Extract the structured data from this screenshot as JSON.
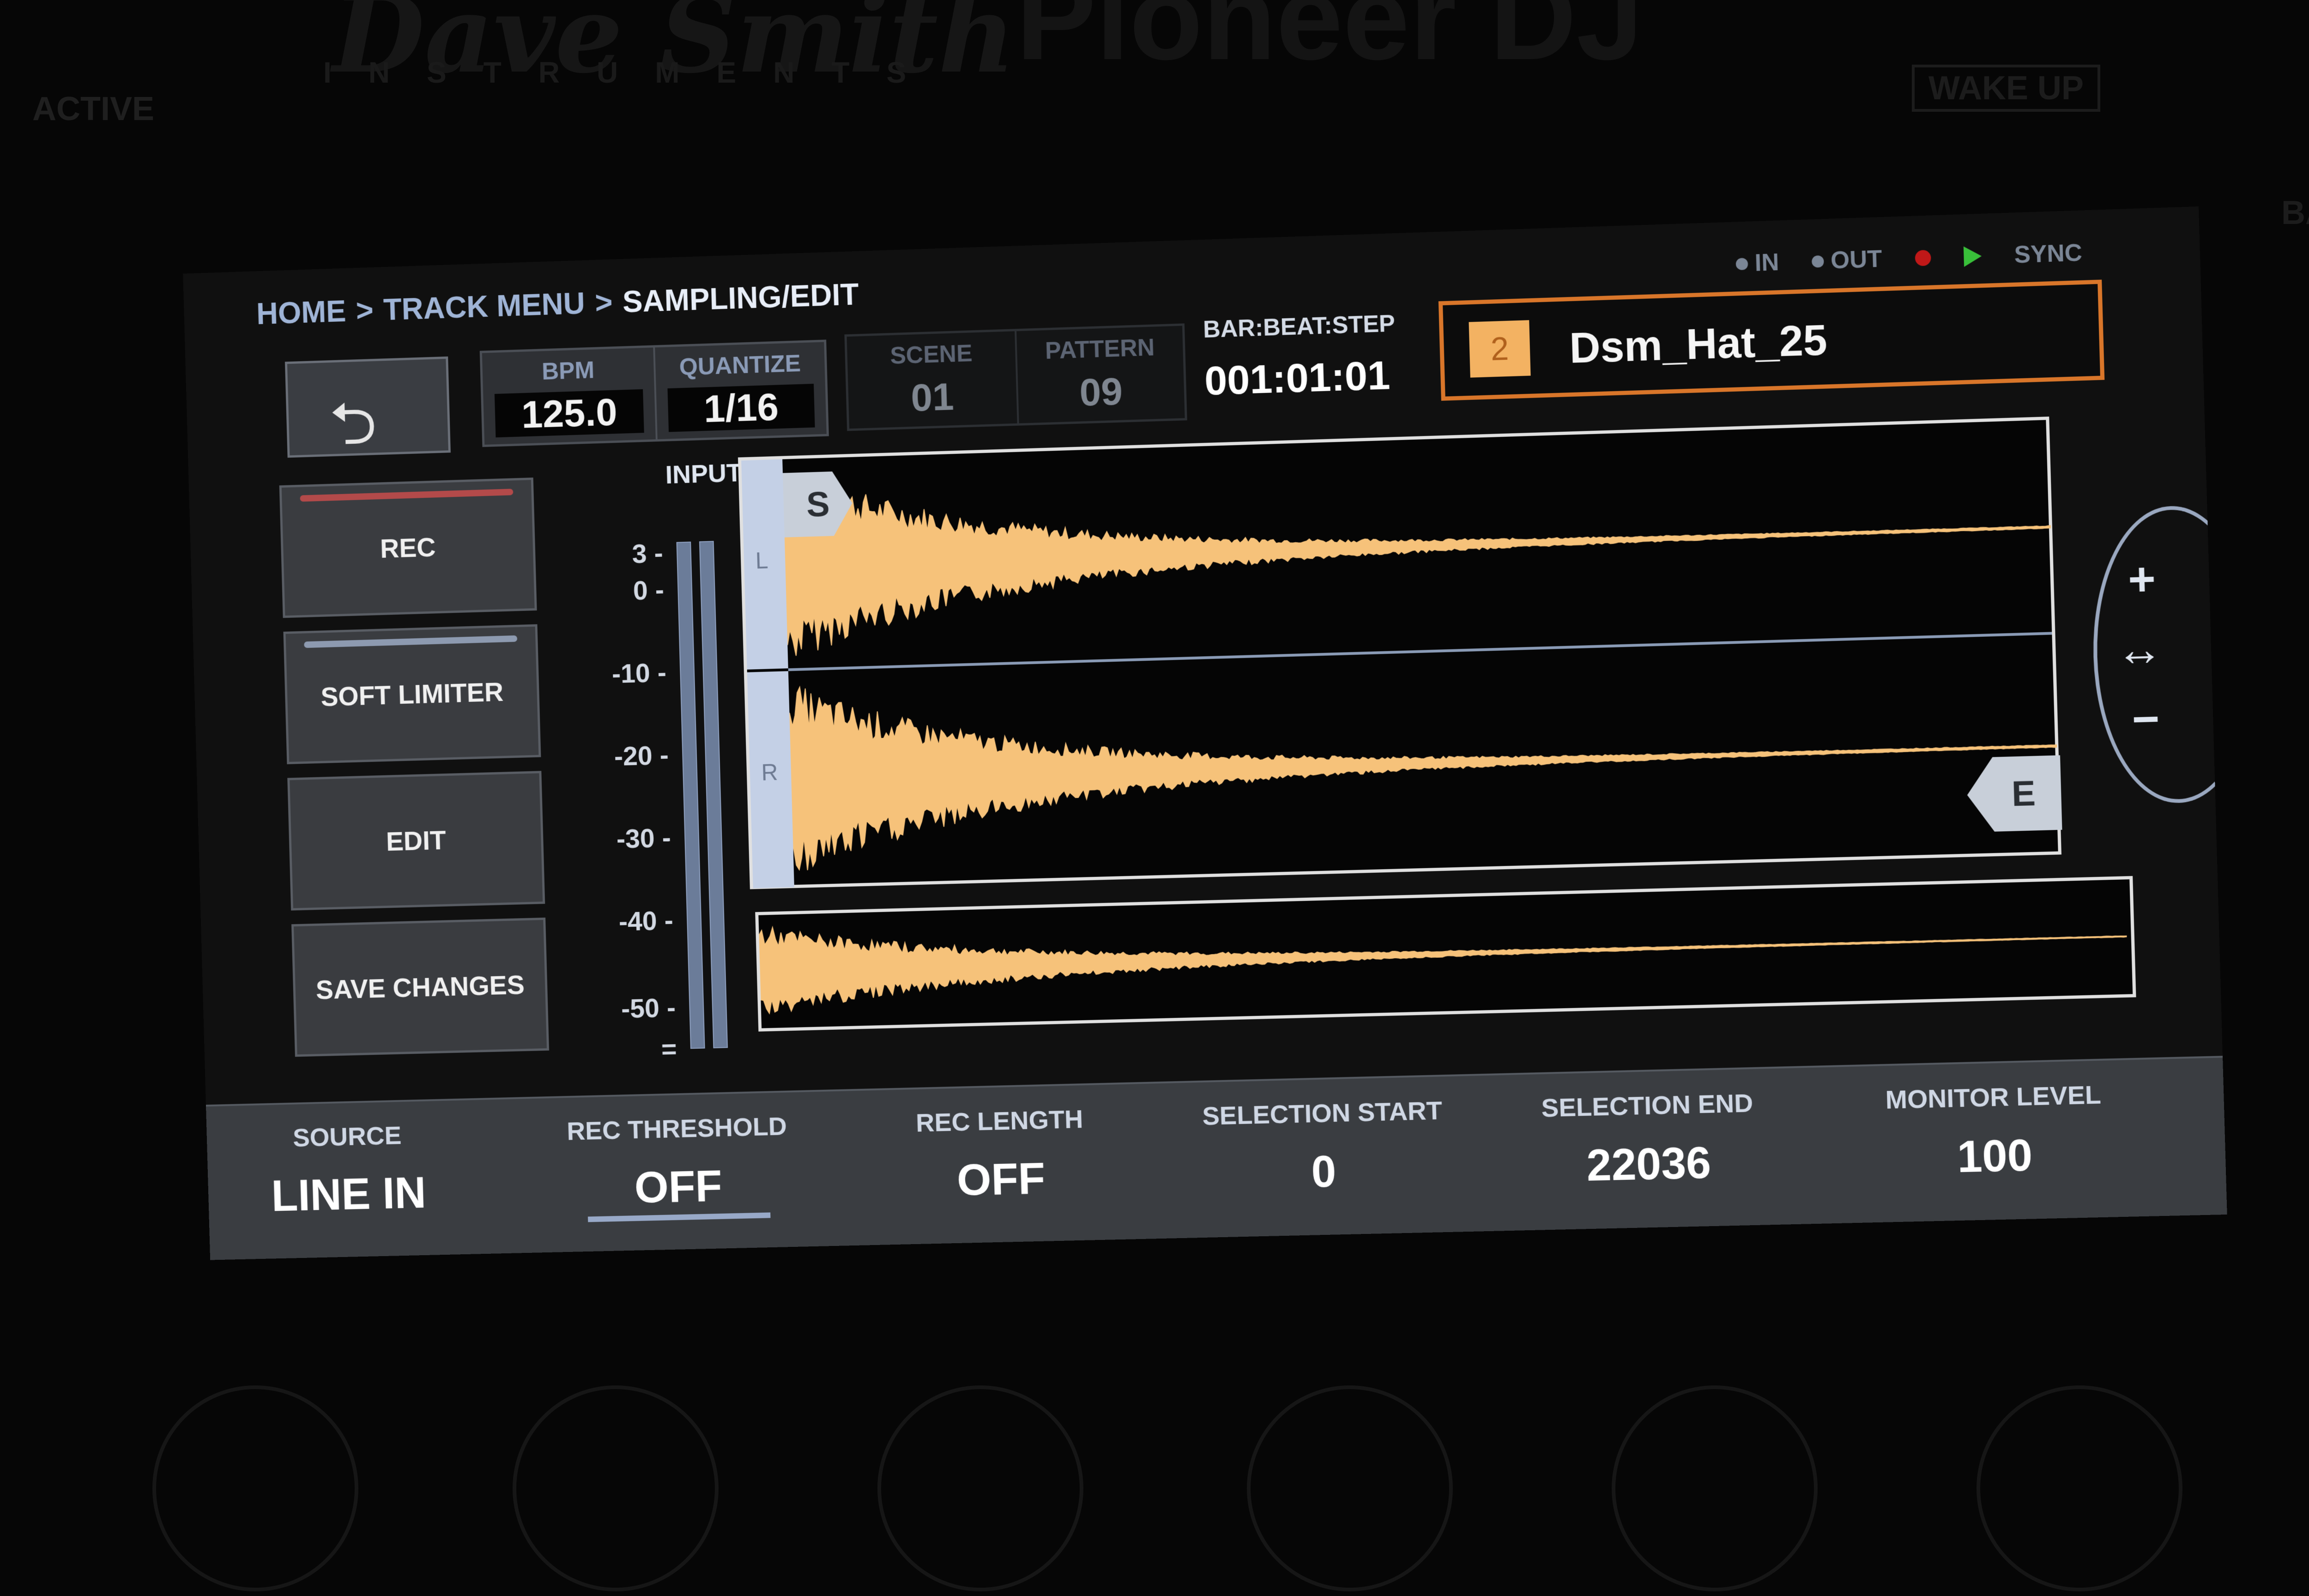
{
  "device": {
    "brand_script": "Dave Smith",
    "brand_sub": "INSTRUMENTS",
    "brand_right": "Pioneer DJ",
    "active_label": "ACTIVE",
    "wake_label": "WAKE UP",
    "back_label": "BA"
  },
  "header": {
    "breadcrumb": [
      "HOME",
      "TRACK MENU",
      "SAMPLING/EDIT"
    ],
    "separator": ">",
    "status": {
      "in": "IN",
      "out": "OUT",
      "sync": "SYNC"
    }
  },
  "transport": {
    "bpm_label": "BPM",
    "bpm": "125.0",
    "quantize_label": "QUANTIZE",
    "quantize": "1/16",
    "scene_label": "SCENE",
    "scene": "01",
    "pattern_label": "PATTERN",
    "pattern": "09",
    "position_label": "BAR:BEAT:STEP",
    "position": "001:01:01"
  },
  "track": {
    "number": "2",
    "name": "Dsm_Hat_25"
  },
  "side_buttons": {
    "rec": "REC",
    "soft_limiter": "SOFT LIMITER",
    "edit": "EDIT",
    "save_changes": "SAVE CHANGES"
  },
  "meter": {
    "label": "INPUT",
    "ticks": [
      "3 -",
      "0 -",
      "-10 -",
      "-20 -",
      "-30 -",
      "-40 -",
      "-50 -",
      "="
    ]
  },
  "waveform": {
    "channel_left": "L",
    "channel_right": "R",
    "start_marker": "S",
    "end_marker": "E",
    "color": "#f6c27a"
  },
  "zoom": {
    "plus": "+",
    "fit": "↔",
    "minus": "−"
  },
  "params": {
    "source_label": "SOURCE",
    "source": "LINE IN",
    "rec_threshold_label": "REC THRESHOLD",
    "rec_threshold": "OFF",
    "rec_length_label": "REC LENGTH",
    "rec_length": "OFF",
    "selection_start_label": "SELECTION START",
    "selection_start": "0",
    "selection_end_label": "SELECTION END",
    "selection_end": "22036",
    "monitor_level_label": "MONITOR LEVEL",
    "monitor_level": "100"
  }
}
